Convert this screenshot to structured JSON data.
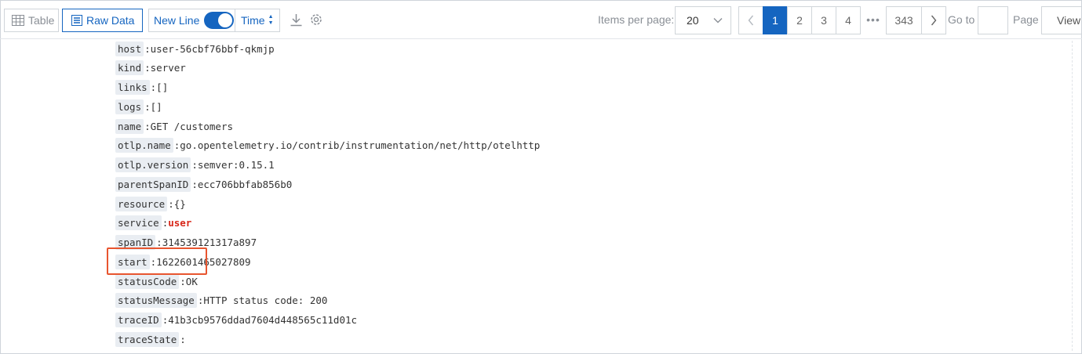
{
  "toolbar": {
    "table_label": "Table",
    "raw_data_label": "Raw Data",
    "new_line_label": "New Line",
    "time_label": "Time",
    "download_icon": "download-icon",
    "settings_icon": "gear-icon"
  },
  "pagination": {
    "items_per_page_label": "Items per page:",
    "items_per_page_value": "20",
    "pages": [
      "1",
      "2",
      "3",
      "4"
    ],
    "current_page": "1",
    "ellipsis": "•••",
    "last_page": "343",
    "goto_label": "Go to",
    "goto_value": "",
    "page_label": "Page",
    "view_label": "View"
  },
  "records": [
    {
      "key": "host",
      "value": "user-56cbf76bbf-qkmjp"
    },
    {
      "key": "kind",
      "value": "server"
    },
    {
      "key": "links",
      "value": "[]"
    },
    {
      "key": "logs",
      "value": "[]"
    },
    {
      "key": "name",
      "value": "GET /customers"
    },
    {
      "key": "otlp.name",
      "value": "go.opentelemetry.io/contrib/instrumentation/net/http/otelhttp"
    },
    {
      "key": "otlp.version",
      "value": "semver:0.15.1"
    },
    {
      "key": "parentSpanID",
      "value": "ecc706bbfab856b0"
    },
    {
      "key": "resource",
      "value": "{}"
    },
    {
      "key": "service",
      "value": "user"
    },
    {
      "key": "spanID",
      "value": "314539121317a897"
    },
    {
      "key": "start",
      "value": "1622601465027809"
    },
    {
      "key": "statusCode",
      "value": "OK"
    },
    {
      "key": "statusMessage",
      "value": "HTTP status code: 200"
    },
    {
      "key": "traceID",
      "value": "41b3cb9576ddad7604d448565c11d01c"
    },
    {
      "key": "traceState",
      "value": ""
    }
  ],
  "colors": {
    "accent": "#1565c0",
    "highlight_value": "#d8281a",
    "highlight_border": "#e8552f",
    "key_background": "#e9edf2"
  }
}
